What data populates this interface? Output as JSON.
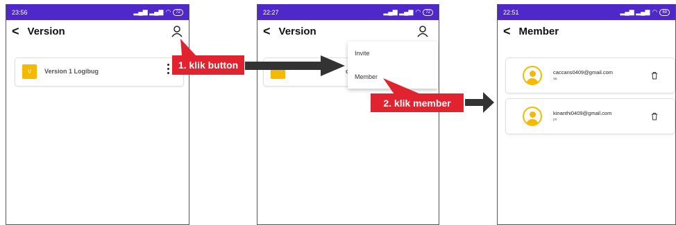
{
  "screen1": {
    "status_time": "23:56",
    "status_icons": "•••",
    "battery": "72",
    "title": "Version",
    "version_badge": "V",
    "version_name": "Version 1 Logibug"
  },
  "screen2": {
    "status_time": "22:27",
    "battery": "72",
    "title": "Version",
    "menu": [
      {
        "label": "Invite"
      },
      {
        "label": "Member"
      }
    ],
    "hidden_text_fragment": "og"
  },
  "screen3": {
    "status_time": "22:51",
    "battery": "69",
    "title": "Member",
    "members": [
      {
        "email": "caccans0409@gmail.com",
        "role": "qa"
      },
      {
        "email": "kinanthi0409@gmail.com",
        "role": "po"
      }
    ]
  },
  "callouts": {
    "step1": "1. klik button",
    "step2": "2. klik member"
  },
  "colors": {
    "status_bar": "#4f28c9",
    "accent": "#f5b900",
    "callout": "#e0232e",
    "arrow": "#333333"
  }
}
